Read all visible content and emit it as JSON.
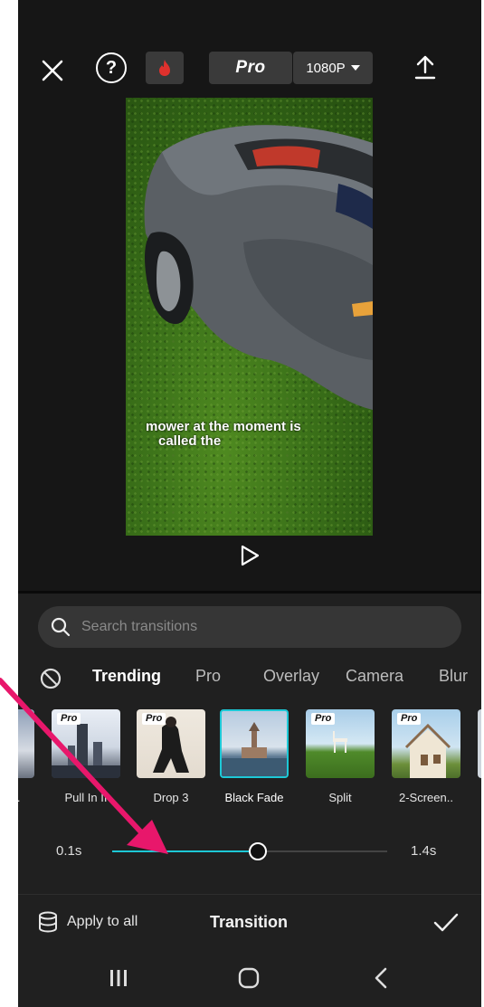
{
  "toolbar": {
    "pro_label": "Pro",
    "resolution_label": "1080P"
  },
  "video": {
    "caption_line1": "mower at the moment is",
    "caption_line2": "called the"
  },
  "search": {
    "placeholder": "Search transitions"
  },
  "categories": [
    "Trending",
    "Pro",
    "Overlay",
    "Camera",
    "Blur"
  ],
  "active_category": "Trending",
  "transitions": [
    {
      "label": "...ot..",
      "pro": false
    },
    {
      "label": "Pull In II",
      "pro": true
    },
    {
      "label": "Drop 3",
      "pro": true
    },
    {
      "label": "Black Fade",
      "pro": false,
      "selected": true
    },
    {
      "label": "Split",
      "pro": true
    },
    {
      "label": "2-Screen..",
      "pro": true
    }
  ],
  "pro_badge": "Pro",
  "duration": {
    "min_label": "0.1s",
    "max_label": "1.4s",
    "value_fraction": 0.53
  },
  "bottom": {
    "apply_label": "Apply to all",
    "title": "Transition"
  },
  "colors": {
    "accent": "#1dc8d6",
    "annotation_arrow": "#e8176b",
    "fire": "#e0312d"
  }
}
